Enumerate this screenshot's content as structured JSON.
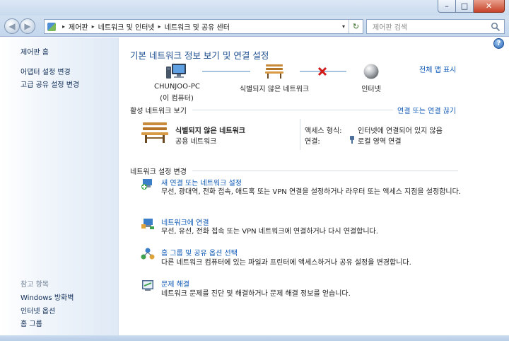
{
  "window": {
    "caption_minimize": "–",
    "caption_maximize": "□",
    "caption_close": "✕"
  },
  "nav": {
    "back_icon": "◀",
    "forward_icon": "▶",
    "breadcrumbs": [
      "제어판",
      "네트워크 및 인터넷",
      "네트워크 및 공유 센터"
    ],
    "crumb_sep": "▸",
    "dropdown_icon": "▾",
    "refresh_icon": "↻",
    "search_placeholder": "제어판 검색"
  },
  "sidebar": {
    "home": "제어판 홈",
    "links": [
      "어댑터 설정 변경",
      "고급 공유 설정 변경"
    ],
    "see_also_label": "참고 항목",
    "see_also": [
      "Windows 방화벽",
      "인터넷 옵션",
      "홈 그룹"
    ]
  },
  "main": {
    "help_icon": "?",
    "title": "기본 네트워크 정보 보기 및 연결 설정",
    "full_map": "전체 맵 표시",
    "map": {
      "computer_label_1": "CHUNJOO-PC",
      "computer_label_2": "(이 컴퓨터)",
      "network_label": "식별되지 않은 네트워크",
      "internet_label": "인터넷"
    },
    "active_networks_heading": "활성 네트워크 보기",
    "connect_disconnect": "연결 또는 연결 끊기",
    "network": {
      "name": "식별되지 않은 네트워크",
      "type": "공용 네트워크",
      "access_type_label": "액세스 형식:",
      "access_type_value": "인터넷에 연결되어 있지 않음",
      "connection_label": "연결:",
      "connection_value": "로컬 영역 연결"
    },
    "change_settings_heading": "네트워크 설정 변경",
    "tasks": [
      {
        "title": "새 연결 또는 네트워크 설정",
        "desc": "무선, 광대역, 전화 접속, 애드혹 또는 VPN 연결을 설정하거나 라우터 또는 액세스 지점을 설정합니다."
      },
      {
        "title": "네트워크에 연결",
        "desc": "무선, 유선, 전화 접속 또는 VPN 네트워크에 연결하거나 다시 연결합니다."
      },
      {
        "title": "홈 그룹 및 공유 옵션 선택",
        "desc": "다른 네트워크 컴퓨터에 있는 파일과 프린터에 액세스하거나 공유 설정을 변경합니다."
      },
      {
        "title": "문제 해결",
        "desc": "네트워크 문제를 진단 및 해결하거나 문제 해결 정보를 얻습니다."
      }
    ]
  }
}
